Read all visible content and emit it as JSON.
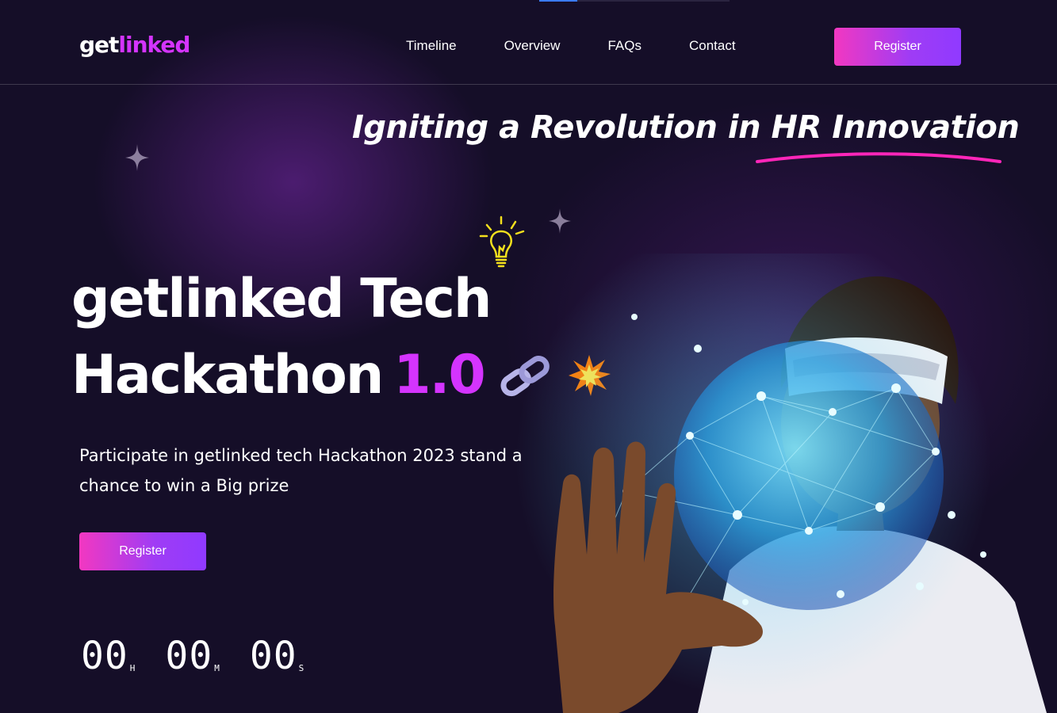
{
  "header": {
    "logo_part1": "get",
    "logo_part2": "linked",
    "nav": [
      "Timeline",
      "Overview",
      "FAQs",
      "Contact"
    ],
    "register_label": "Register"
  },
  "hero": {
    "tagline_main": "Igniting a Revolution in ",
    "tagline_highlight": "HR Innovation",
    "title_line1": "getlinked Tech",
    "title_line2": "Hackathon",
    "title_version": "1.0",
    "subtitle": "Participate in getlinked tech Hackathon 2023 stand a chance to win a Big prize",
    "register_label": "Register"
  },
  "countdown": {
    "hours": "00",
    "hours_label": "H",
    "minutes": "00",
    "minutes_label": "M",
    "seconds": "00",
    "seconds_label": "S"
  },
  "colors": {
    "background": "#150e28",
    "accent": "#d434fe",
    "button_start": "#f238c1",
    "button_end": "#903aff",
    "underline": "#ff26b9"
  },
  "icons": [
    "lightbulb-icon",
    "chain-link-icon",
    "explosion-icon",
    "sparkle-star-icon"
  ]
}
